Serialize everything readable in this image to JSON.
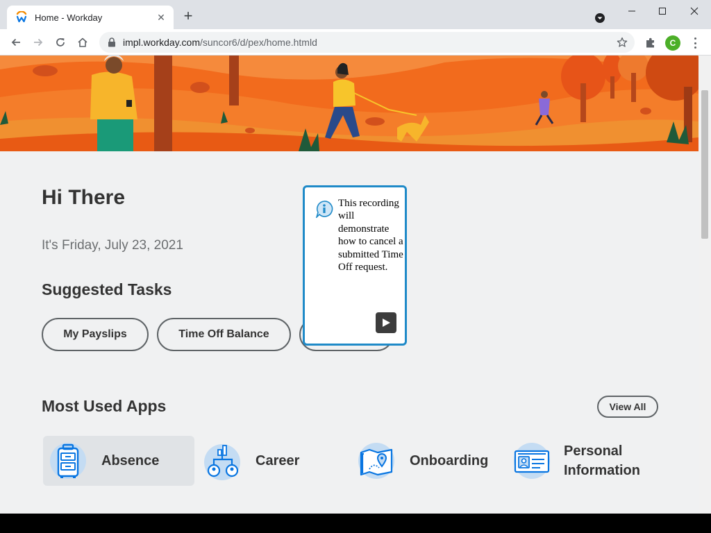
{
  "browser": {
    "tab_title": "Home - Workday",
    "tab_close": "✕",
    "new_tab": "+",
    "url_host": "impl.workday.com",
    "url_path": "/suncor6/d/pex/home.htmld",
    "profile_initial": "C"
  },
  "page": {
    "greeting": "Hi There",
    "date": "It's Friday, July 23, 2021",
    "suggested_title": "Suggested Tasks",
    "tasks": [
      {
        "label": "My Payslips"
      },
      {
        "label": "Time Off Balance"
      }
    ],
    "apps_title": "Most Used Apps",
    "view_all": "View All",
    "apps": [
      {
        "label": "Absence"
      },
      {
        "label": "Career"
      },
      {
        "label": "Onboarding"
      },
      {
        "label": "Personal Information"
      }
    ]
  },
  "callout": {
    "text": "This recording will demonstrate how to cancel a submitted Time Off request."
  },
  "colors": {
    "accent_blue": "#1f8ac8",
    "workday_orange": "#f38b00",
    "hero_orange": "#f26b1d"
  },
  "icons": [
    "workday-logo-icon",
    "close-icon",
    "plus-icon",
    "chevron-down-icon",
    "minimize-icon",
    "maximize-icon",
    "window-close-icon",
    "back-arrow-icon",
    "forward-arrow-icon",
    "reload-icon",
    "home-icon",
    "lock-icon",
    "star-icon",
    "puzzle-icon",
    "kebab-menu-icon",
    "info-icon",
    "play-icon"
  ]
}
